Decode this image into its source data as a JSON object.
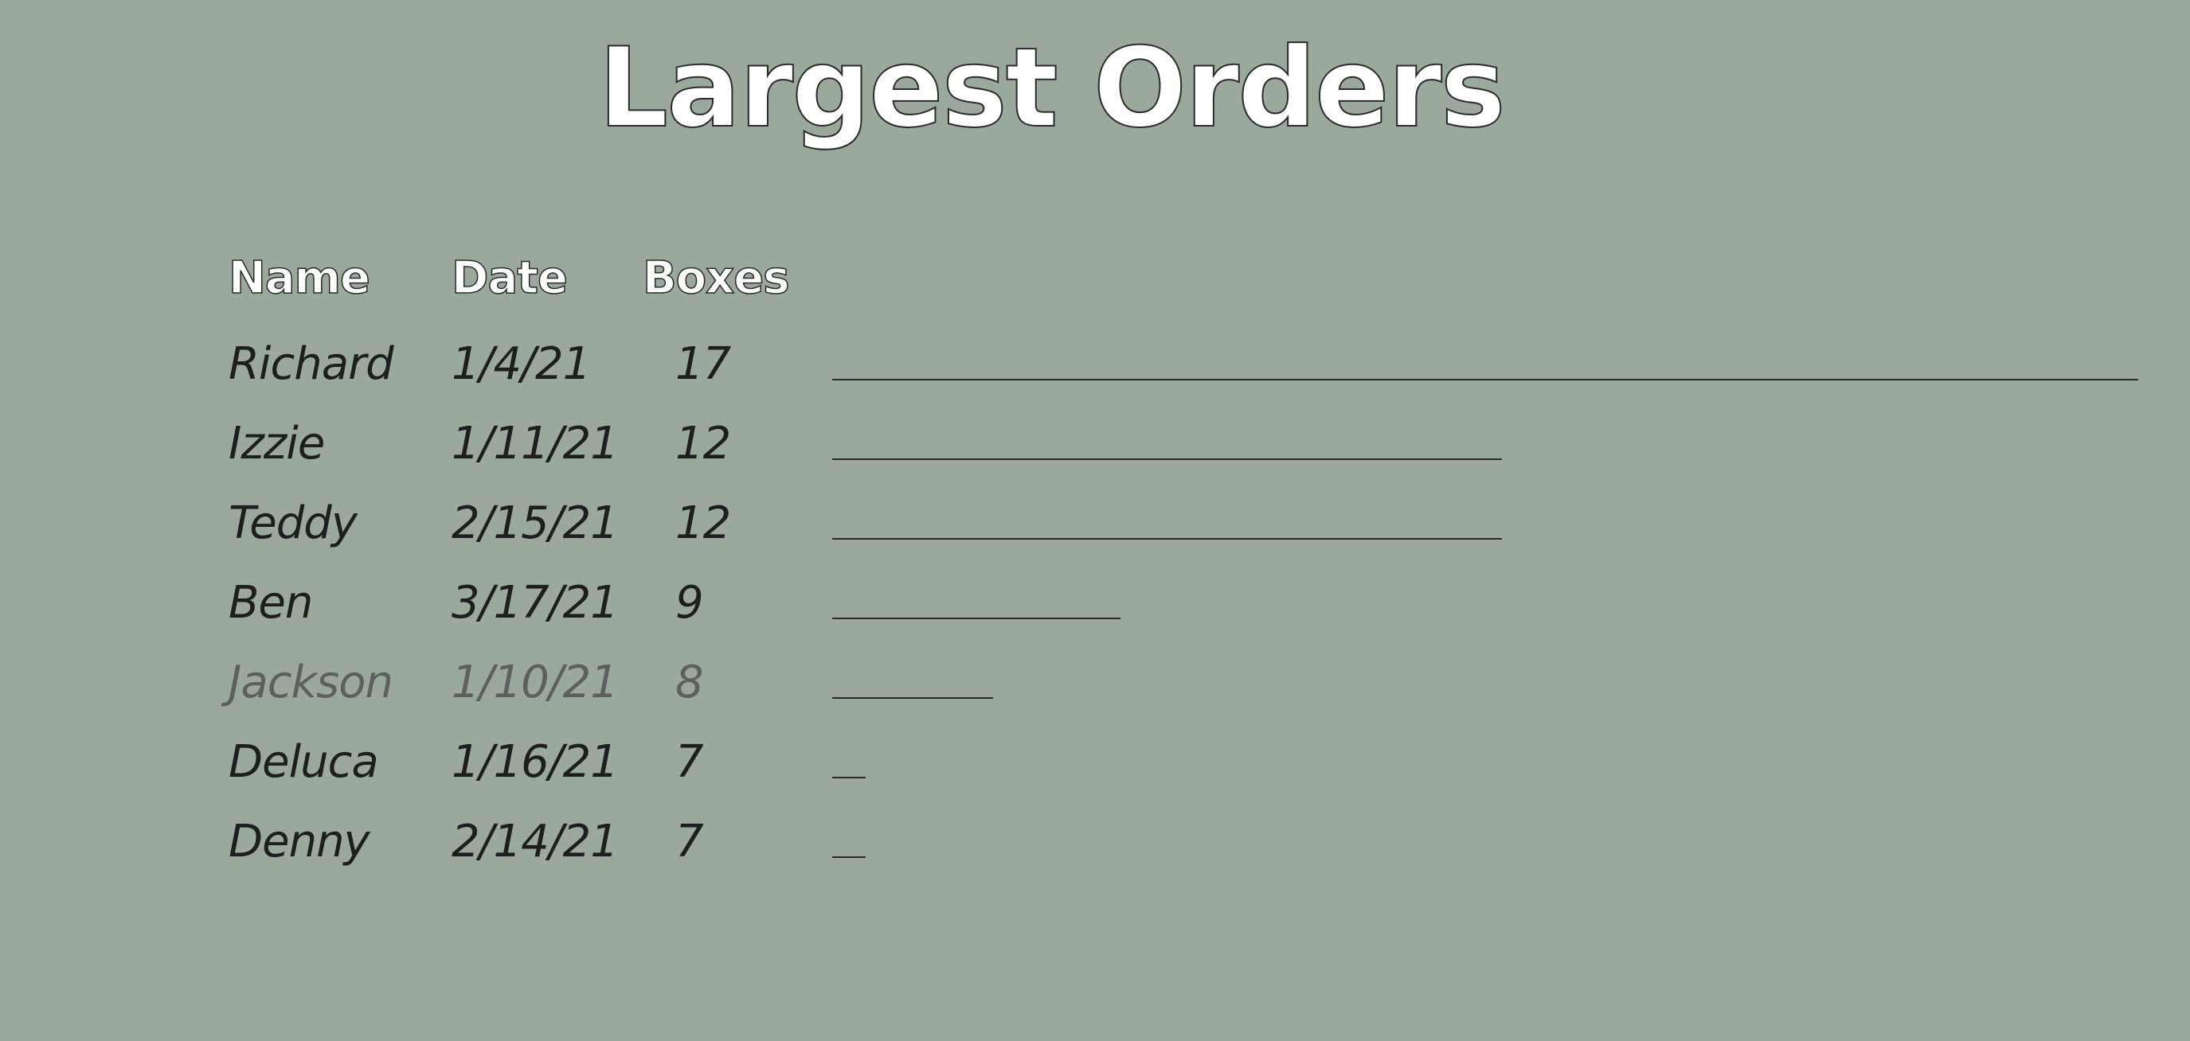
{
  "chart_data": {
    "type": "bar",
    "title": "Largest Orders",
    "columns": [
      "Name",
      "Date",
      "Boxes"
    ],
    "rows": [
      {
        "name": "Richard",
        "date": "1/4/21",
        "boxes": 17
      },
      {
        "name": "Izzie",
        "date": "1/11/21",
        "boxes": 12
      },
      {
        "name": "Teddy",
        "date": "2/15/21",
        "boxes": 12
      },
      {
        "name": "Ben",
        "date": "3/17/21",
        "boxes": 9
      },
      {
        "name": "Jackson",
        "date": "1/10/21",
        "boxes": 8,
        "faded": true
      },
      {
        "name": "Deluca",
        "date": "1/16/21",
        "boxes": 7
      },
      {
        "name": "Denny",
        "date": "2/14/21",
        "boxes": 7
      }
    ],
    "bar_min": 7,
    "bar_max": 17
  },
  "colors": {
    "background": "#9aa99c",
    "text": "#1e1e1e",
    "faded_text": "#5f5f5f",
    "bar": "#2a2a2a",
    "heading_fill": "#ffffff"
  }
}
